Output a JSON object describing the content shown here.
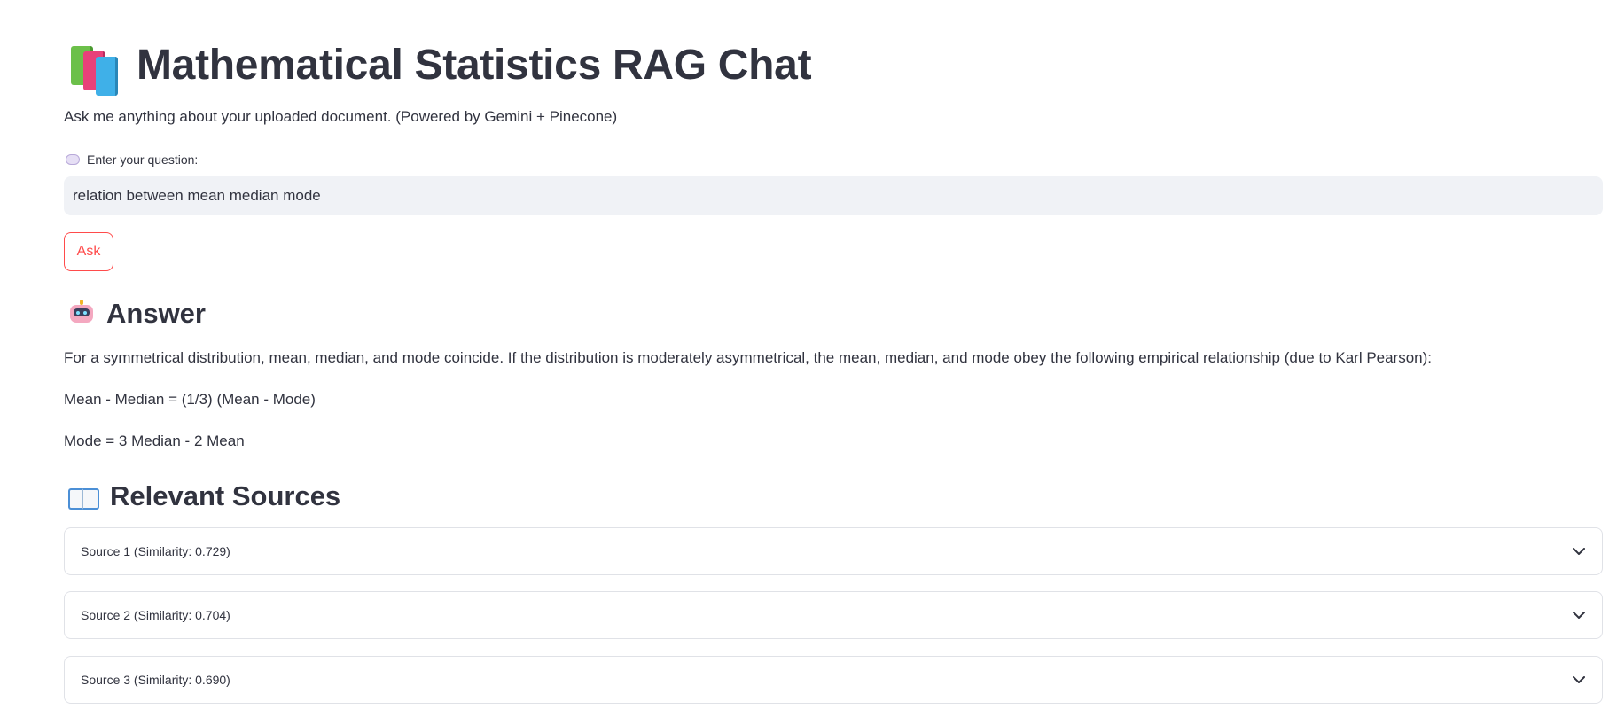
{
  "header": {
    "icon": "books-icon",
    "title": "Mathematical Statistics RAG Chat",
    "subtitle": "Ask me anything about your uploaded document. (Powered by Gemini + Pinecone)"
  },
  "question": {
    "icon": "speech-bubble-icon",
    "label": "Enter your question:",
    "value": "relation between mean median mode"
  },
  "ask_button": {
    "label": "Ask",
    "color": "#ff4b4b"
  },
  "answer": {
    "icon": "robot-icon",
    "heading": "Answer",
    "paragraphs": [
      "For a symmetrical distribution, mean, median, and mode coincide. If the distribution is moderately asymmetrical, the mean, median, and mode obey the following empirical relationship (due to Karl Pearson):",
      "Mean - Median = (1/3) (Mean - Mode)",
      "Mode = 3 Median - 2 Mean"
    ]
  },
  "sources": {
    "icon": "open-book-icon",
    "heading": "Relevant Sources",
    "items": [
      {
        "label": "Source 1 (Similarity: 0.729)",
        "icon": "chevron-down-icon"
      },
      {
        "label": "Source 2 (Similarity: 0.704)",
        "icon": "chevron-down-icon"
      },
      {
        "label": "Source 3 (Similarity: 0.690)",
        "icon": "chevron-down-icon"
      }
    ]
  },
  "colors": {
    "text": "#31333f",
    "input_bg": "#f0f2f6",
    "accent": "#ff4b4b",
    "border": "#e0e2e7"
  }
}
